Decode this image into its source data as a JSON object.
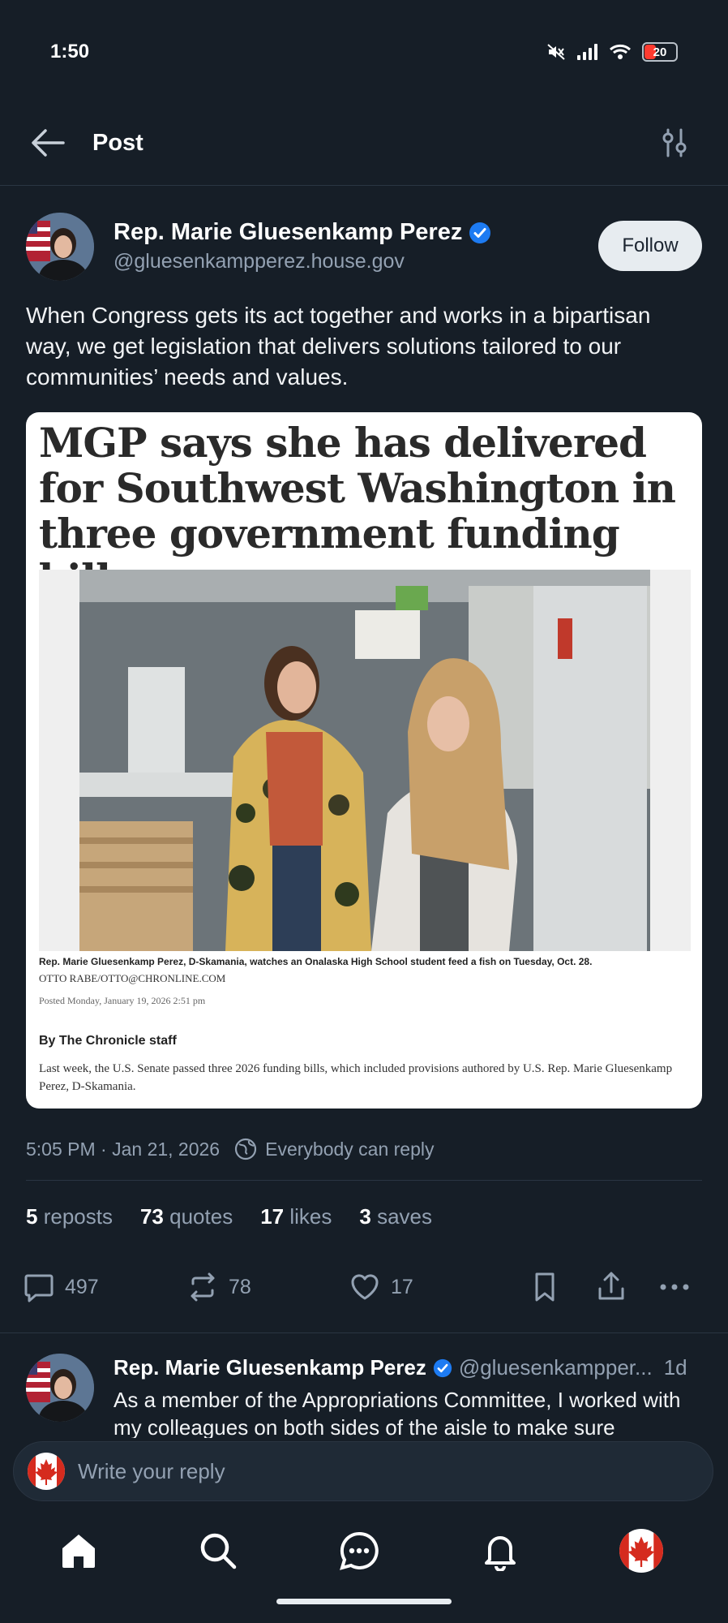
{
  "status_bar": {
    "time": "1:50",
    "battery": "20"
  },
  "header": {
    "title": "Post"
  },
  "post": {
    "author_name": "Rep. Marie Gluesenkamp Perez",
    "author_handle": "@gluesenkampperez.house.gov",
    "follow_label": "Follow",
    "text": "When Congress gets its act together and works in a bipartisan way, we get legislation that delivers solutions tailored to our communities’ needs and values.",
    "embed": {
      "headline": "MGP says she has delivered for Southwest Washington in three government funding bills",
      "caption": "Rep. Marie Gluesenkamp Perez, D-Skamania, watches an Onalaska High School student feed a fish on Tuesday, Oct. 28.",
      "credit": "OTTO RABE/OTTO@CHRONLINE.COM",
      "posted": "Posted Monday, January 19, 2026 2:51 pm",
      "byline": "By The Chronicle staff",
      "lede": "Last week, the U.S. Senate passed three 2026 funding bills, which included provisions authored by U.S. Rep. Marie Gluesenkamp Perez, D-Skamania."
    },
    "timestamp": "5:05 PM · Jan 21, 2026",
    "reply_setting": "Everybody can reply",
    "stats": {
      "reposts_count": "5",
      "reposts_label": "reposts",
      "quotes_count": "73",
      "quotes_label": "quotes",
      "likes_count": "17",
      "likes_label": "likes",
      "saves_count": "3",
      "saves_label": "saves"
    },
    "actions": {
      "replies": "497",
      "reposts": "78",
      "likes": "17"
    }
  },
  "reply_preview": {
    "author_name": "Rep. Marie Gluesenkamp Perez",
    "handle": "@gluesenkampper...",
    "age": "1d",
    "text": "As a member of the Appropriations Committee, I worked with my colleagues on both sides of the aisle to make sure"
  },
  "composer": {
    "placeholder": "Write your reply"
  },
  "colors": {
    "background": "#161e27",
    "accent": "#1d7bf2",
    "muted": "#93a1b2"
  }
}
